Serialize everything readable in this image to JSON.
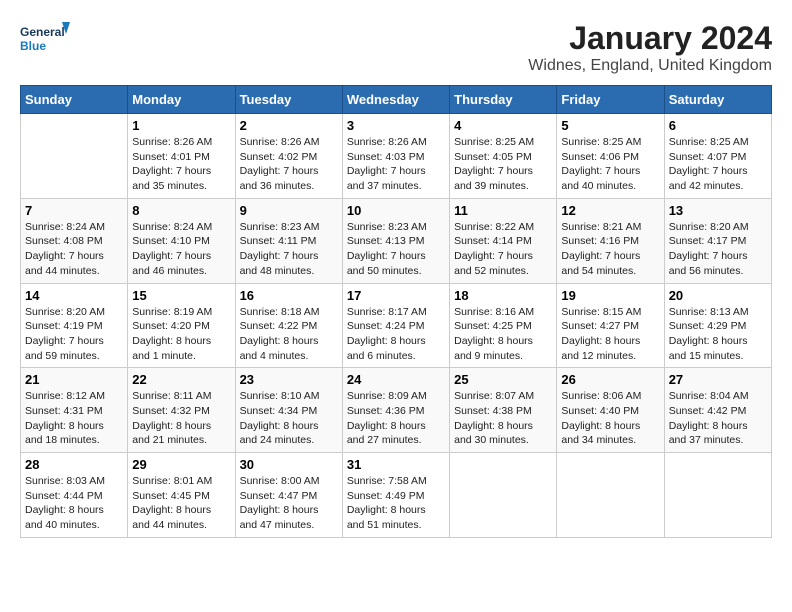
{
  "logo": {
    "line1": "General",
    "line2": "Blue"
  },
  "title": "January 2024",
  "subtitle": "Widnes, England, United Kingdom",
  "header": {
    "accent_color": "#2b6cb0"
  },
  "columns": [
    "Sunday",
    "Monday",
    "Tuesday",
    "Wednesday",
    "Thursday",
    "Friday",
    "Saturday"
  ],
  "weeks": [
    [
      {
        "day": "",
        "sunrise": "",
        "sunset": "",
        "daylight": ""
      },
      {
        "day": "1",
        "sunrise": "Sunrise: 8:26 AM",
        "sunset": "Sunset: 4:01 PM",
        "daylight": "Daylight: 7 hours and 35 minutes."
      },
      {
        "day": "2",
        "sunrise": "Sunrise: 8:26 AM",
        "sunset": "Sunset: 4:02 PM",
        "daylight": "Daylight: 7 hours and 36 minutes."
      },
      {
        "day": "3",
        "sunrise": "Sunrise: 8:26 AM",
        "sunset": "Sunset: 4:03 PM",
        "daylight": "Daylight: 7 hours and 37 minutes."
      },
      {
        "day": "4",
        "sunrise": "Sunrise: 8:25 AM",
        "sunset": "Sunset: 4:05 PM",
        "daylight": "Daylight: 7 hours and 39 minutes."
      },
      {
        "day": "5",
        "sunrise": "Sunrise: 8:25 AM",
        "sunset": "Sunset: 4:06 PM",
        "daylight": "Daylight: 7 hours and 40 minutes."
      },
      {
        "day": "6",
        "sunrise": "Sunrise: 8:25 AM",
        "sunset": "Sunset: 4:07 PM",
        "daylight": "Daylight: 7 hours and 42 minutes."
      }
    ],
    [
      {
        "day": "7",
        "sunrise": "Sunrise: 8:24 AM",
        "sunset": "Sunset: 4:08 PM",
        "daylight": "Daylight: 7 hours and 44 minutes."
      },
      {
        "day": "8",
        "sunrise": "Sunrise: 8:24 AM",
        "sunset": "Sunset: 4:10 PM",
        "daylight": "Daylight: 7 hours and 46 minutes."
      },
      {
        "day": "9",
        "sunrise": "Sunrise: 8:23 AM",
        "sunset": "Sunset: 4:11 PM",
        "daylight": "Daylight: 7 hours and 48 minutes."
      },
      {
        "day": "10",
        "sunrise": "Sunrise: 8:23 AM",
        "sunset": "Sunset: 4:13 PM",
        "daylight": "Daylight: 7 hours and 50 minutes."
      },
      {
        "day": "11",
        "sunrise": "Sunrise: 8:22 AM",
        "sunset": "Sunset: 4:14 PM",
        "daylight": "Daylight: 7 hours and 52 minutes."
      },
      {
        "day": "12",
        "sunrise": "Sunrise: 8:21 AM",
        "sunset": "Sunset: 4:16 PM",
        "daylight": "Daylight: 7 hours and 54 minutes."
      },
      {
        "day": "13",
        "sunrise": "Sunrise: 8:20 AM",
        "sunset": "Sunset: 4:17 PM",
        "daylight": "Daylight: 7 hours and 56 minutes."
      }
    ],
    [
      {
        "day": "14",
        "sunrise": "Sunrise: 8:20 AM",
        "sunset": "Sunset: 4:19 PM",
        "daylight": "Daylight: 7 hours and 59 minutes."
      },
      {
        "day": "15",
        "sunrise": "Sunrise: 8:19 AM",
        "sunset": "Sunset: 4:20 PM",
        "daylight": "Daylight: 8 hours and 1 minute."
      },
      {
        "day": "16",
        "sunrise": "Sunrise: 8:18 AM",
        "sunset": "Sunset: 4:22 PM",
        "daylight": "Daylight: 8 hours and 4 minutes."
      },
      {
        "day": "17",
        "sunrise": "Sunrise: 8:17 AM",
        "sunset": "Sunset: 4:24 PM",
        "daylight": "Daylight: 8 hours and 6 minutes."
      },
      {
        "day": "18",
        "sunrise": "Sunrise: 8:16 AM",
        "sunset": "Sunset: 4:25 PM",
        "daylight": "Daylight: 8 hours and 9 minutes."
      },
      {
        "day": "19",
        "sunrise": "Sunrise: 8:15 AM",
        "sunset": "Sunset: 4:27 PM",
        "daylight": "Daylight: 8 hours and 12 minutes."
      },
      {
        "day": "20",
        "sunrise": "Sunrise: 8:13 AM",
        "sunset": "Sunset: 4:29 PM",
        "daylight": "Daylight: 8 hours and 15 minutes."
      }
    ],
    [
      {
        "day": "21",
        "sunrise": "Sunrise: 8:12 AM",
        "sunset": "Sunset: 4:31 PM",
        "daylight": "Daylight: 8 hours and 18 minutes."
      },
      {
        "day": "22",
        "sunrise": "Sunrise: 8:11 AM",
        "sunset": "Sunset: 4:32 PM",
        "daylight": "Daylight: 8 hours and 21 minutes."
      },
      {
        "day": "23",
        "sunrise": "Sunrise: 8:10 AM",
        "sunset": "Sunset: 4:34 PM",
        "daylight": "Daylight: 8 hours and 24 minutes."
      },
      {
        "day": "24",
        "sunrise": "Sunrise: 8:09 AM",
        "sunset": "Sunset: 4:36 PM",
        "daylight": "Daylight: 8 hours and 27 minutes."
      },
      {
        "day": "25",
        "sunrise": "Sunrise: 8:07 AM",
        "sunset": "Sunset: 4:38 PM",
        "daylight": "Daylight: 8 hours and 30 minutes."
      },
      {
        "day": "26",
        "sunrise": "Sunrise: 8:06 AM",
        "sunset": "Sunset: 4:40 PM",
        "daylight": "Daylight: 8 hours and 34 minutes."
      },
      {
        "day": "27",
        "sunrise": "Sunrise: 8:04 AM",
        "sunset": "Sunset: 4:42 PM",
        "daylight": "Daylight: 8 hours and 37 minutes."
      }
    ],
    [
      {
        "day": "28",
        "sunrise": "Sunrise: 8:03 AM",
        "sunset": "Sunset: 4:44 PM",
        "daylight": "Daylight: 8 hours and 40 minutes."
      },
      {
        "day": "29",
        "sunrise": "Sunrise: 8:01 AM",
        "sunset": "Sunset: 4:45 PM",
        "daylight": "Daylight: 8 hours and 44 minutes."
      },
      {
        "day": "30",
        "sunrise": "Sunrise: 8:00 AM",
        "sunset": "Sunset: 4:47 PM",
        "daylight": "Daylight: 8 hours and 47 minutes."
      },
      {
        "day": "31",
        "sunrise": "Sunrise: 7:58 AM",
        "sunset": "Sunset: 4:49 PM",
        "daylight": "Daylight: 8 hours and 51 minutes."
      },
      {
        "day": "",
        "sunrise": "",
        "sunset": "",
        "daylight": ""
      },
      {
        "day": "",
        "sunrise": "",
        "sunset": "",
        "daylight": ""
      },
      {
        "day": "",
        "sunrise": "",
        "sunset": "",
        "daylight": ""
      }
    ]
  ]
}
